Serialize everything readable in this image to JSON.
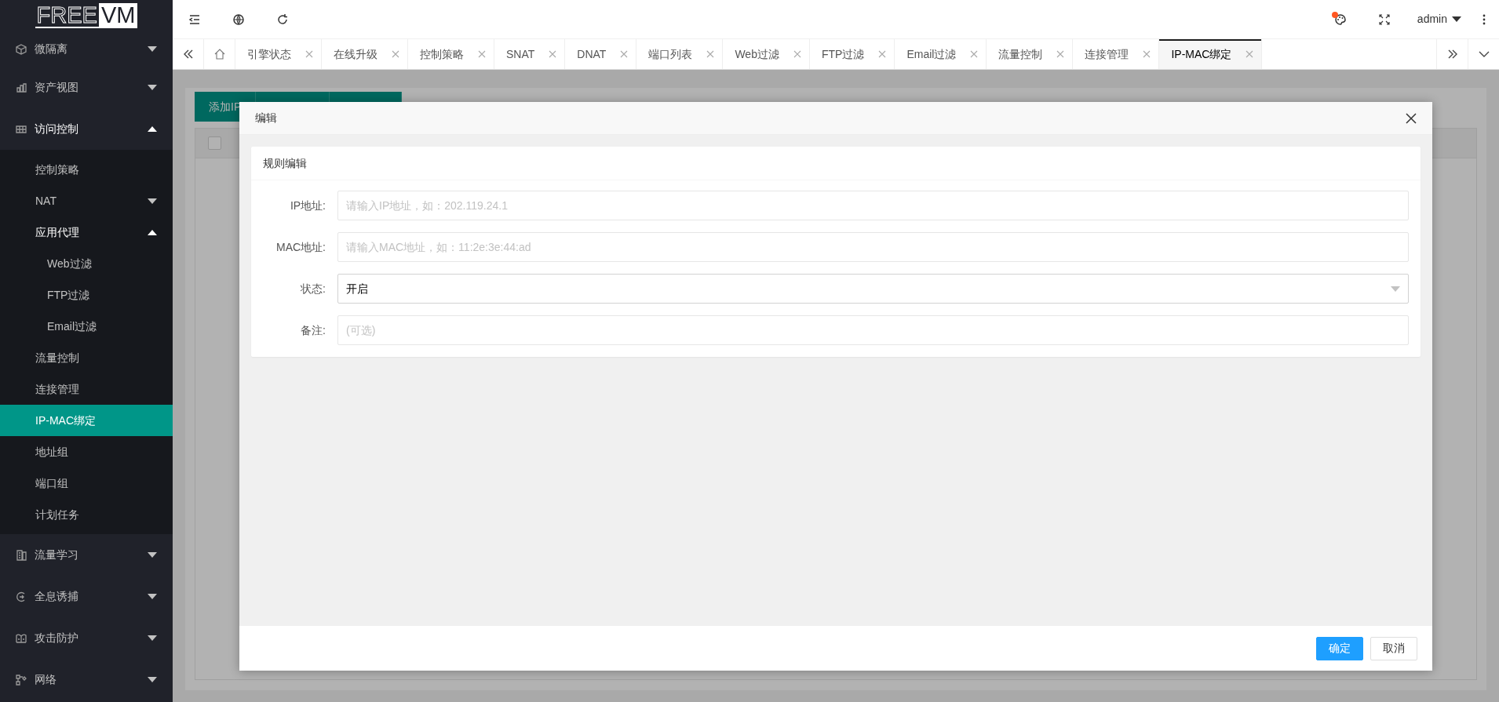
{
  "logo": {
    "light_part": "FREE",
    "boxed_part": "VM"
  },
  "sidebar": {
    "items": [
      {
        "label": "微隔离",
        "expanded": false,
        "selected": false
      },
      {
        "label": "资产视图",
        "expanded": false,
        "selected": false
      },
      {
        "label": "访问控制",
        "expanded": true,
        "selected": false,
        "children": [
          {
            "label": "控制策略",
            "selected": false
          },
          {
            "label": "NAT",
            "expanded": false,
            "selected": false
          },
          {
            "label": "应用代理",
            "expanded": true,
            "selected": false,
            "children": [
              {
                "label": "Web过滤",
                "selected": false
              },
              {
                "label": "FTP过滤",
                "selected": false
              },
              {
                "label": "Email过滤",
                "selected": false
              }
            ]
          },
          {
            "label": "流量控制",
            "selected": false
          },
          {
            "label": "连接管理",
            "selected": false
          },
          {
            "label": "IP-MAC绑定",
            "selected": true
          },
          {
            "label": "地址组",
            "selected": false
          },
          {
            "label": "端口组",
            "selected": false
          },
          {
            "label": "计划任务",
            "selected": false
          }
        ]
      },
      {
        "label": "流量学习",
        "expanded": false,
        "selected": false
      },
      {
        "label": "全息诱捕",
        "expanded": false,
        "selected": false
      },
      {
        "label": "攻击防护",
        "expanded": false,
        "selected": false
      },
      {
        "label": "网络",
        "expanded": false,
        "selected": false
      }
    ]
  },
  "topbar": {
    "user": "admin",
    "theme_notification": true
  },
  "tabs": [
    {
      "label": "引擎状态",
      "selected": false
    },
    {
      "label": "在线升级",
      "selected": false
    },
    {
      "label": "控制策略",
      "selected": false
    },
    {
      "label": "SNAT",
      "selected": false
    },
    {
      "label": "DNAT",
      "selected": false
    },
    {
      "label": "端口列表",
      "selected": false
    },
    {
      "label": "Web过滤",
      "selected": false
    },
    {
      "label": "FTP过滤",
      "selected": false
    },
    {
      "label": "Email过滤",
      "selected": false
    },
    {
      "label": "流量控制",
      "selected": false
    },
    {
      "label": "连接管理",
      "selected": false
    },
    {
      "label": "IP-MAC绑定",
      "selected": true
    }
  ],
  "background": {
    "toolbar_button": "添加IP",
    "select_all_checked": false
  },
  "modal": {
    "title": "编辑",
    "panel_title": "规则编辑",
    "fields": [
      {
        "kind": "input",
        "label": "IP地址:",
        "placeholder": "请输入IP地址，如：202.119.24.1"
      },
      {
        "kind": "input",
        "label": "MAC地址:",
        "placeholder": "请输入MAC地址，如：11:2e:3e:44:ad"
      },
      {
        "kind": "select",
        "label": "状态:",
        "value": "开启"
      },
      {
        "kind": "input",
        "label": "备注:",
        "placeholder": "(可选)"
      }
    ],
    "buttons": [
      {
        "label": "确定",
        "kind": "primary"
      },
      {
        "label": "取消",
        "kind": "secondary"
      }
    ]
  }
}
